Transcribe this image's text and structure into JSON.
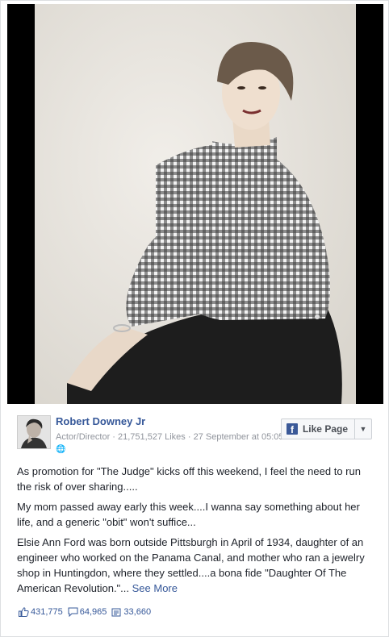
{
  "post": {
    "author": "Robert Downey Jr",
    "meta_line": "Actor/Director · 21,751,527 Likes · 27 September at 05:05 ·",
    "like_page_label": "Like Page",
    "paragraphs": [
      "As promotion for \"The Judge\" kicks off this weekend, I feel the need to run the risk of over sharing.....",
      "My mom passed away early this week....I wanna say something about her life, and a generic \"obit\" won't suffice...",
      "Elsie Ann Ford was born outside Pittsburgh in April of 1934, daughter of an engineer who worked on the Panama Canal, and mother who ran a jewelry shop in Huntingdon, where they settled....a bona fide \"Daughter Of The American Revolution.\"... "
    ],
    "see_more": "See More",
    "likes": "431,775",
    "comments": "64,965",
    "shares": "33,660"
  },
  "icons": {
    "facebook": "facebook-f-icon",
    "dropdown": "chevron-down-icon",
    "privacy": "globe-icon",
    "like": "thumbs-up-icon",
    "comment": "comment-icon",
    "share": "share-icon"
  },
  "colors": {
    "link": "#365899",
    "meta": "#90949c",
    "text": "#1d2129",
    "facebook_blue": "#3b5998"
  }
}
